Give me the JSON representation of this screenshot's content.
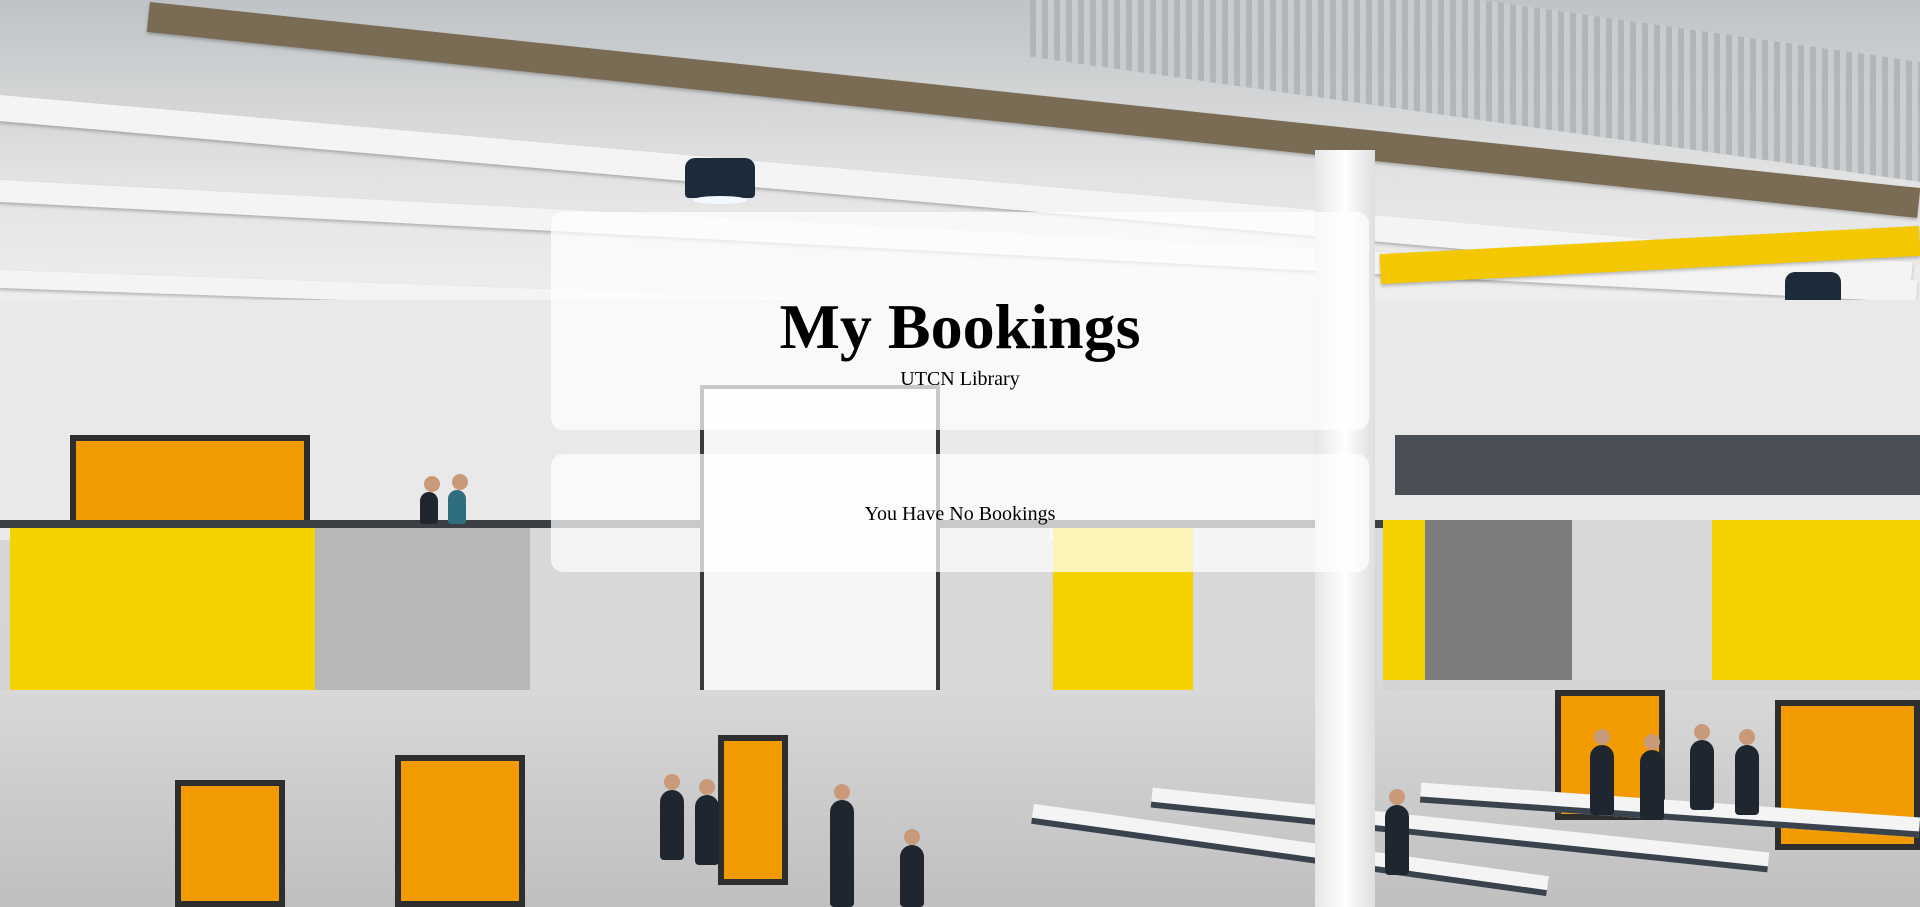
{
  "header": {
    "title": "My Bookings",
    "subtitle": "UTCN Library"
  },
  "bookings": {
    "empty_message": "You Have No Bookings",
    "items": []
  },
  "background": {
    "description_icon": "library-hall-photo"
  }
}
